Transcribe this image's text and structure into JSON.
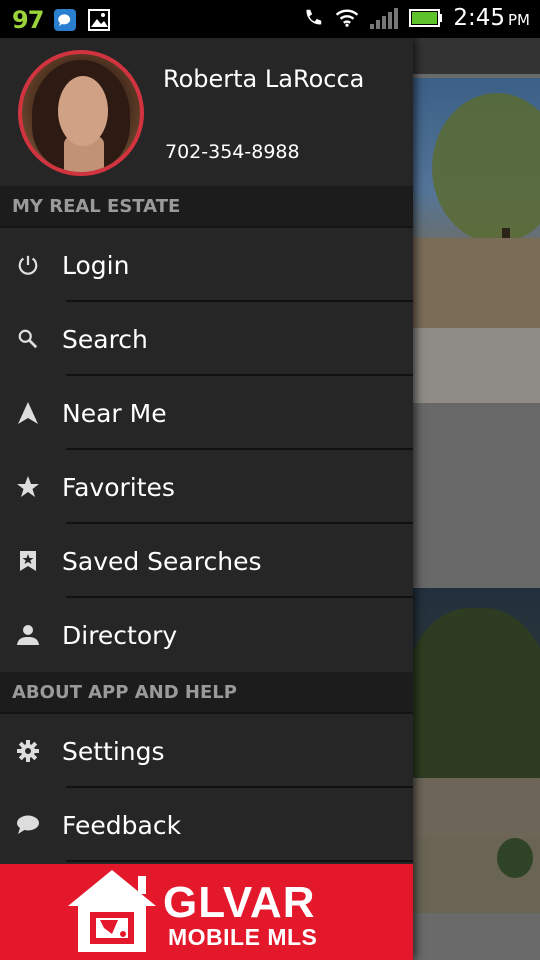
{
  "status_bar": {
    "battery_percent_text": "97",
    "time": "2:45",
    "ampm": "PM",
    "icons": [
      "chat-notification-icon",
      "image-notification-icon",
      "phone-icon",
      "wifi-icon",
      "signal-icon",
      "battery-icon"
    ]
  },
  "profile": {
    "name": "Roberta LaRocca",
    "phone": "702-354-8988"
  },
  "sections": {
    "my_real_estate": "MY REAL ESTATE",
    "about": "ABOUT APP AND HELP"
  },
  "menu": [
    {
      "label": "Login",
      "icon": "power-icon"
    },
    {
      "label": "Search",
      "icon": "search-icon"
    },
    {
      "label": "Near Me",
      "icon": "navigation-arrow-icon"
    },
    {
      "label": "Favorites",
      "icon": "star-icon"
    },
    {
      "label": "Saved Searches",
      "icon": "bookmark-star-icon"
    },
    {
      "label": "Directory",
      "icon": "person-icon"
    }
  ],
  "help_menu": [
    {
      "label": "Settings",
      "icon": "gear-icon"
    },
    {
      "label": "Feedback",
      "icon": "speech-bubble-icon"
    }
  ],
  "brand": {
    "line1": "GLVAR",
    "line2": "MOBILE MLS",
    "color": "#e3192b"
  }
}
